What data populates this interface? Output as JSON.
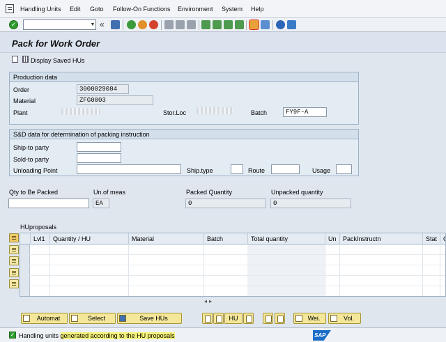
{
  "menu": [
    "Handling Units",
    "Edit",
    "Goto",
    "Follow-On Functions",
    "Environment",
    "System",
    "Help"
  ],
  "toolbar": {
    "command_value": "",
    "icons": [
      "enter-icon",
      "save-icon",
      "back-icon",
      "exit-icon",
      "cancel-icon",
      "print-icon",
      "find-icon",
      "find-next-icon",
      "first-page-icon",
      "prev-page-icon",
      "next-page-icon",
      "last-page-icon",
      "create-session-icon",
      "shortcut-icon",
      "help-icon",
      "customize-icon"
    ]
  },
  "title": "Pack for Work Order",
  "app_toolbar": {
    "display_saved": "Display Saved HUs"
  },
  "production": {
    "title": "Production data",
    "order_label": "Order",
    "order_value": "3000029084",
    "material_label": "Material",
    "material_value": "ZFG0003",
    "plant_label": "Plant",
    "storloc_label": "Stor.Loc",
    "batch_label": "Batch",
    "batch_value": "FY9F-A"
  },
  "sd": {
    "title": "S&D data for determination of packing instruction",
    "shipto_label": "Ship-to party",
    "soldto_label": "Sold-to party",
    "unloading_label": "Unloading Point",
    "shiptype_label": "Ship.type",
    "route_label": "Route",
    "usage_label": "Usage"
  },
  "qty": {
    "to_pack_label": "Qty to Be Packed",
    "uom_label": "Un.of meas",
    "uom_value": "EA",
    "packed_label": "Packed Quantity",
    "packed_value": "0",
    "unpacked_label": "Unpacked quantity",
    "unpacked_value": "0"
  },
  "table": {
    "title": "HUproposals",
    "columns": [
      "Lvl1",
      "Quantity / HU",
      "Material",
      "Batch",
      "Total quantity",
      "Un",
      "PackInstructn",
      "Stat",
      "C"
    ]
  },
  "buttons": {
    "automat": "Automat",
    "select": "Select",
    "save_hus": "Save HUs",
    "hu": "HU",
    "wei": "Wei.",
    "vol": "Vol."
  },
  "status": {
    "prefix": "Handling units ",
    "highlight": "generated according to the HU proposals",
    "sap": "SAP"
  },
  "colors": {
    "ok_green": "#2e9c2e",
    "button_yellow": "#f4e79a",
    "highlight": "#f7f37a"
  }
}
